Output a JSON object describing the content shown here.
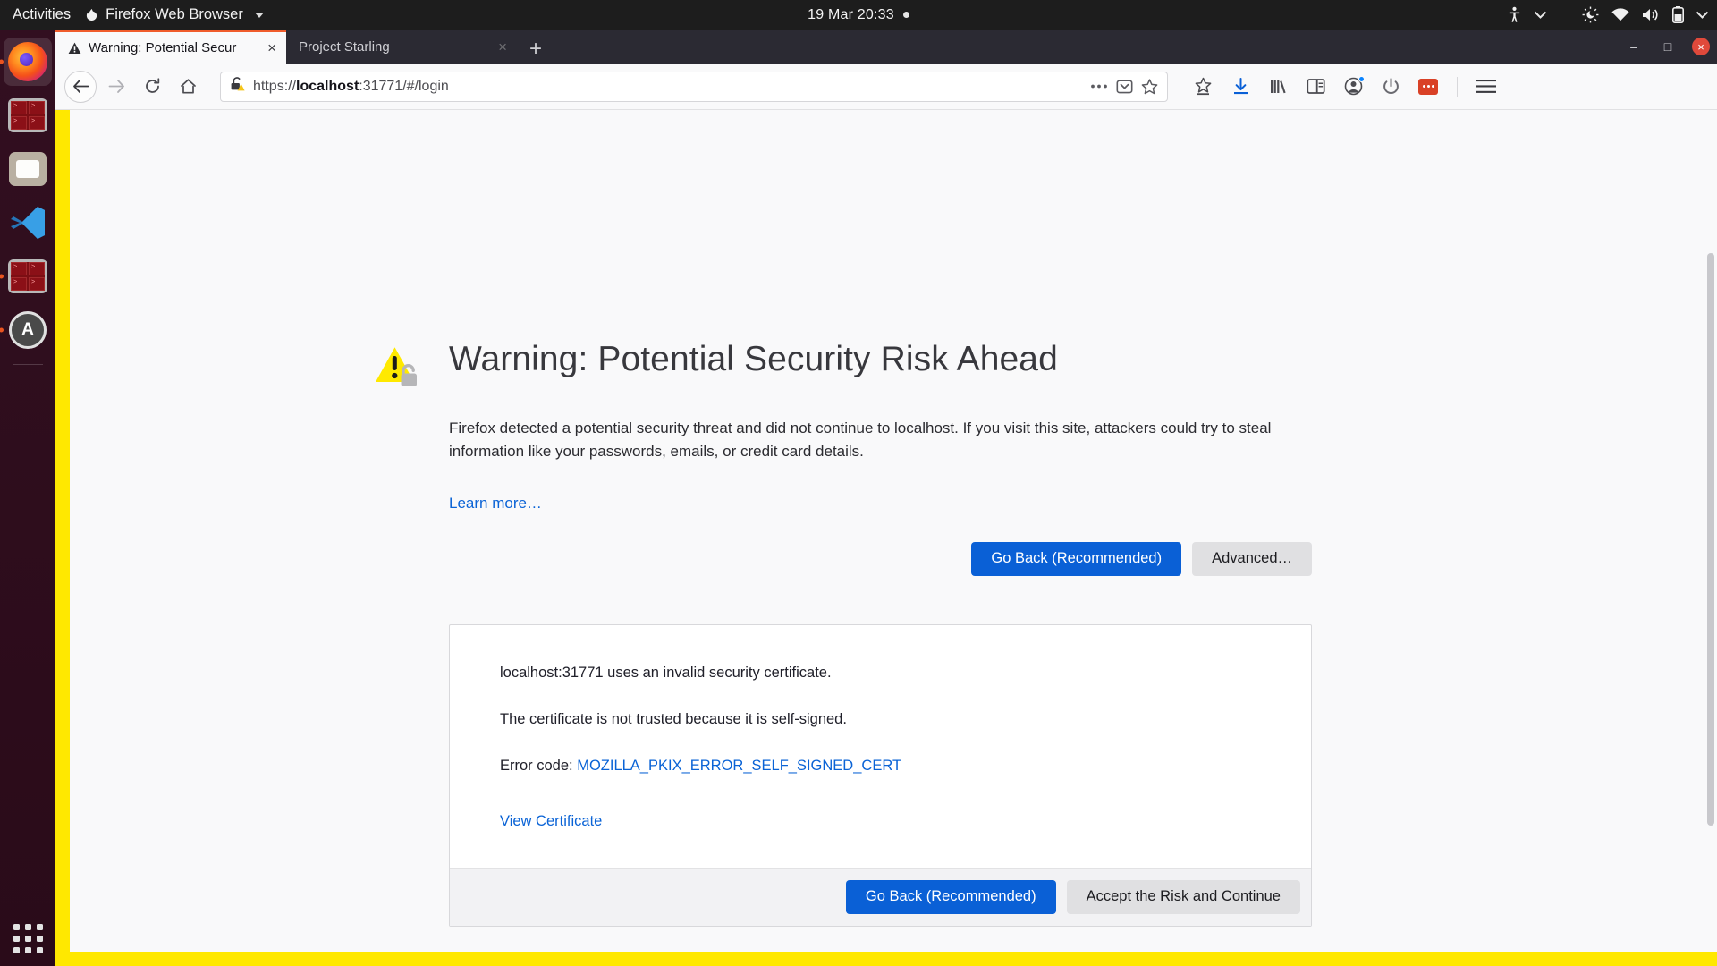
{
  "desktop": {
    "activities_label": "Activities",
    "app_menu_label": "Firefox Web Browser",
    "clock": "19 Mar  20:33",
    "tray_icons": [
      "accessibility-icon",
      "chevron-down-icon",
      "night-light-icon",
      "wifi-icon",
      "volume-icon",
      "battery-icon",
      "chevron-down-icon"
    ],
    "dock_items": [
      {
        "name": "firefox",
        "label": "Firefox Web Browser",
        "running": true,
        "active": true
      },
      {
        "name": "terminal",
        "label": "Terminal",
        "running": false,
        "active": false
      },
      {
        "name": "files",
        "label": "Files",
        "running": false,
        "active": false
      },
      {
        "name": "vscode",
        "label": "Visual Studio Code",
        "running": false,
        "active": false
      },
      {
        "name": "terminal-2",
        "label": "Terminal",
        "running": true,
        "active": false
      },
      {
        "name": "ubuntu-software",
        "label": "Ubuntu Software",
        "running": true,
        "active": false
      }
    ],
    "show_apps_label": "Show Applications"
  },
  "browser": {
    "tabs": [
      {
        "title": "Warning: Potential Secur",
        "active": true,
        "icon": "warning-triangle-icon",
        "close_label": "×"
      },
      {
        "title": "Project Starling",
        "active": false,
        "icon": "none",
        "close_label": "×"
      }
    ],
    "new_tab_label": "+",
    "window_controls": {
      "minimize": "–",
      "maximize": "□",
      "close": "×"
    },
    "nav": {
      "back": "←",
      "forward": "→",
      "reload": "↻",
      "home": "⌂"
    },
    "urlbar": {
      "scheme": "https://",
      "host": "localhost",
      "path": ":31771/#/login",
      "full_url": "https://localhost:31771/#/login",
      "security_icon": "broken-lock-warning-icon",
      "page_actions_icon": "ellipsis-icon",
      "pocket_icon": "pocket-icon",
      "bookmark_icon": "star-icon"
    },
    "toolbar_right": [
      "save-to-pocket-icon",
      "downloads-icon",
      "library-icon",
      "sidebar-icon",
      "account-icon",
      "power-icon",
      "extension-badge-icon",
      "hamburger-menu-icon"
    ]
  },
  "error_page": {
    "icon": "warning-triangle-padlock-icon",
    "title": "Warning: Potential Security Risk Ahead",
    "body": "Firefox detected a potential security threat and did not continue to localhost. If you visit this site, attackers could try to steal information like your passwords, emails, or credit card details.",
    "learn_more": "Learn more…",
    "go_back_label": "Go Back (Recommended)",
    "advanced_label": "Advanced…",
    "advanced_panel": {
      "line1": "localhost:31771 uses an invalid security certificate.",
      "line2": "The certificate is not trusted because it is self-signed.",
      "error_code_label": "Error code: ",
      "error_code": "MOZILLA_PKIX_ERROR_SELF_SIGNED_CERT",
      "view_certificate": "View Certificate",
      "go_back_label": "Go Back (Recommended)",
      "accept_risk_label": "Accept the Risk and Continue"
    }
  },
  "colors": {
    "accent_blue": "#0a60d6",
    "link_blue": "#0a63d6",
    "warning_yellow": "#ffe800",
    "tab_accent": "#f05c2c",
    "dock_bg": "#2c0c1c"
  }
}
